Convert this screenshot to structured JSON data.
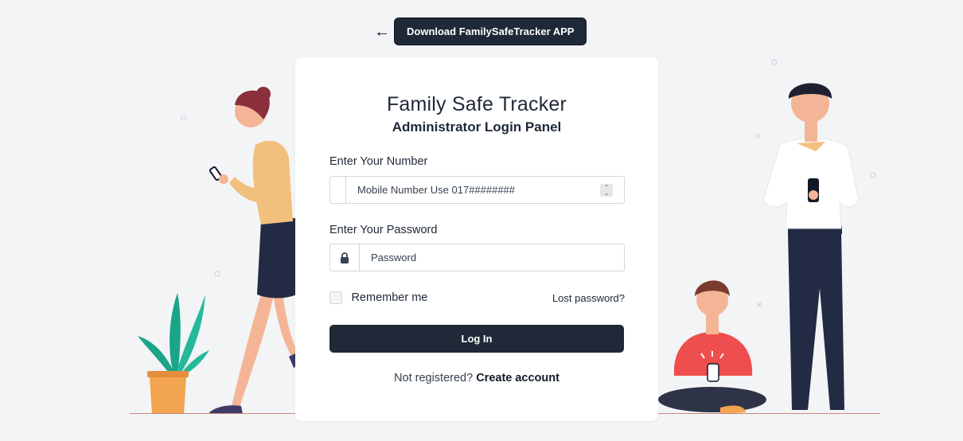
{
  "top": {
    "back_icon": "arrow-left-icon",
    "back_glyph": "←",
    "download_label": "Download FamilySafeTracker APP"
  },
  "login": {
    "title": "Family Safe Tracker",
    "subtitle": "Administrator Login Panel",
    "number_label": "Enter Your Number",
    "number_placeholder": "Mobile Number Use 017########",
    "password_label": "Enter Your Password",
    "password_placeholder": "Password",
    "remember_label": "Remember me",
    "lost_password": "Lost password?",
    "login_button": "Log In",
    "not_registered": "Not registered?",
    "create_account": "Create account"
  },
  "colors": {
    "background": "#f3f4f6",
    "card": "#ffffff",
    "primary": "#1f2937",
    "ground_line": "#c98a7a"
  }
}
